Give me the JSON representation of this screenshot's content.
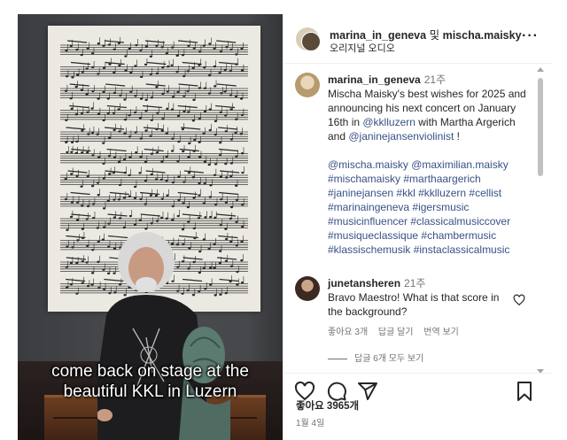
{
  "video": {
    "caption_line1": "come back on stage at the",
    "caption_line2": "beautiful KKL in Luzern"
  },
  "header": {
    "user1": "marina_in_geneva",
    "conjunction": "및",
    "user2": "mischa.maisky",
    "audio": "오리지널 오디오",
    "more_icon": "more-horizontal-icon"
  },
  "post": {
    "username": "marina_in_geneva",
    "time": "21주",
    "text_before": "Mischa Maisky's best wishes for 2025 and announcing his next concert on January 16th in ",
    "mention1": "@kklluzern",
    "text_middle": " with Martha Argerich and ",
    "mention2": "@janinejansenviolinist",
    "text_after": " !",
    "tags": "@mischa.maisky @maximilian.maisky #mischamaisky #marthaargerich #janinejansen #kkl #kklluzern #cellist #marinaingeneva #igersmusic #musicinfluencer #classicalmusiccover #musiqueclassique #chambermusic #klassischemusik #instaclassicalmusic"
  },
  "comment": {
    "username": "junetansheren",
    "time": "21주",
    "text": "Bravo Maestro! What is that score in the background?",
    "likes": "좋아요 3개",
    "reply": "답글 달기",
    "translate": "번역 보기",
    "view_replies": "답글 6개 모두 보기"
  },
  "actions": {
    "like_icon": "heart-icon",
    "comment_icon": "comment-icon",
    "share_icon": "send-icon",
    "save_icon": "bookmark-icon"
  },
  "likes_count": "좋아요 3965개",
  "date": "1월 4일",
  "colors": {
    "link": "#385185",
    "secondary_text": "#737373",
    "text": "#262626"
  }
}
